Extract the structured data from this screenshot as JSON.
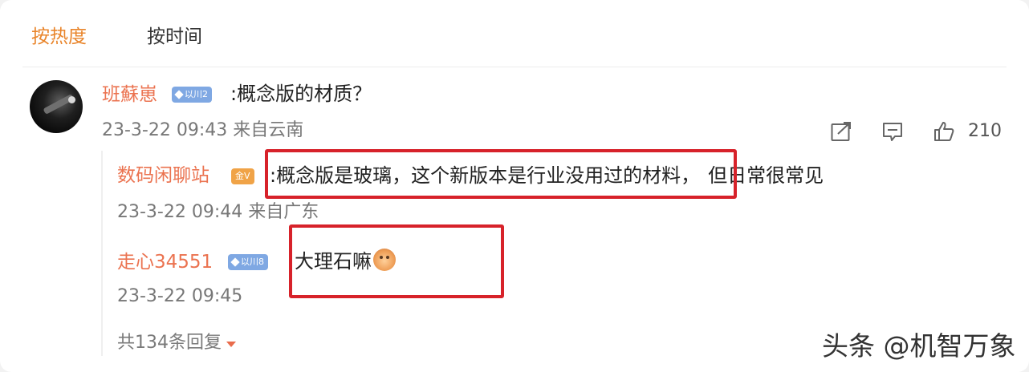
{
  "sort_tabs": {
    "hot": "按热度",
    "time": "按时间"
  },
  "colors": {
    "active_tab": "#e9852b",
    "username": "#eb7350",
    "highlight": "#d7222a",
    "badge_blue": "#7fa8e3",
    "badge_orange": "#f0a347"
  },
  "comment": {
    "user": "班蘇崽",
    "badge": "以川2",
    "text": ":概念版的材质？",
    "meta": "23-3-22 09:43 来自云南",
    "actions": {
      "share_icon": "share-icon",
      "comment_icon": "comment-icon",
      "like_icon": "thumbs-up-icon",
      "like_count": "210"
    }
  },
  "replies": [
    {
      "user": "数码闲聊站",
      "badge": "金V",
      "text_highlight": ":概念版是玻璃，这个新版本是行业没用过的材料，",
      "text_rest": "但日常很常见",
      "meta": "23-3-22 09:44 来自广东"
    },
    {
      "user": "走心34551",
      "badge": "以川8",
      "text": "大理石嘛",
      "emoji": "shiba-dog-emoji",
      "meta": "23-3-22 09:45"
    }
  ],
  "more_replies": "共134条回复",
  "watermark": "头条 @机智万象"
}
